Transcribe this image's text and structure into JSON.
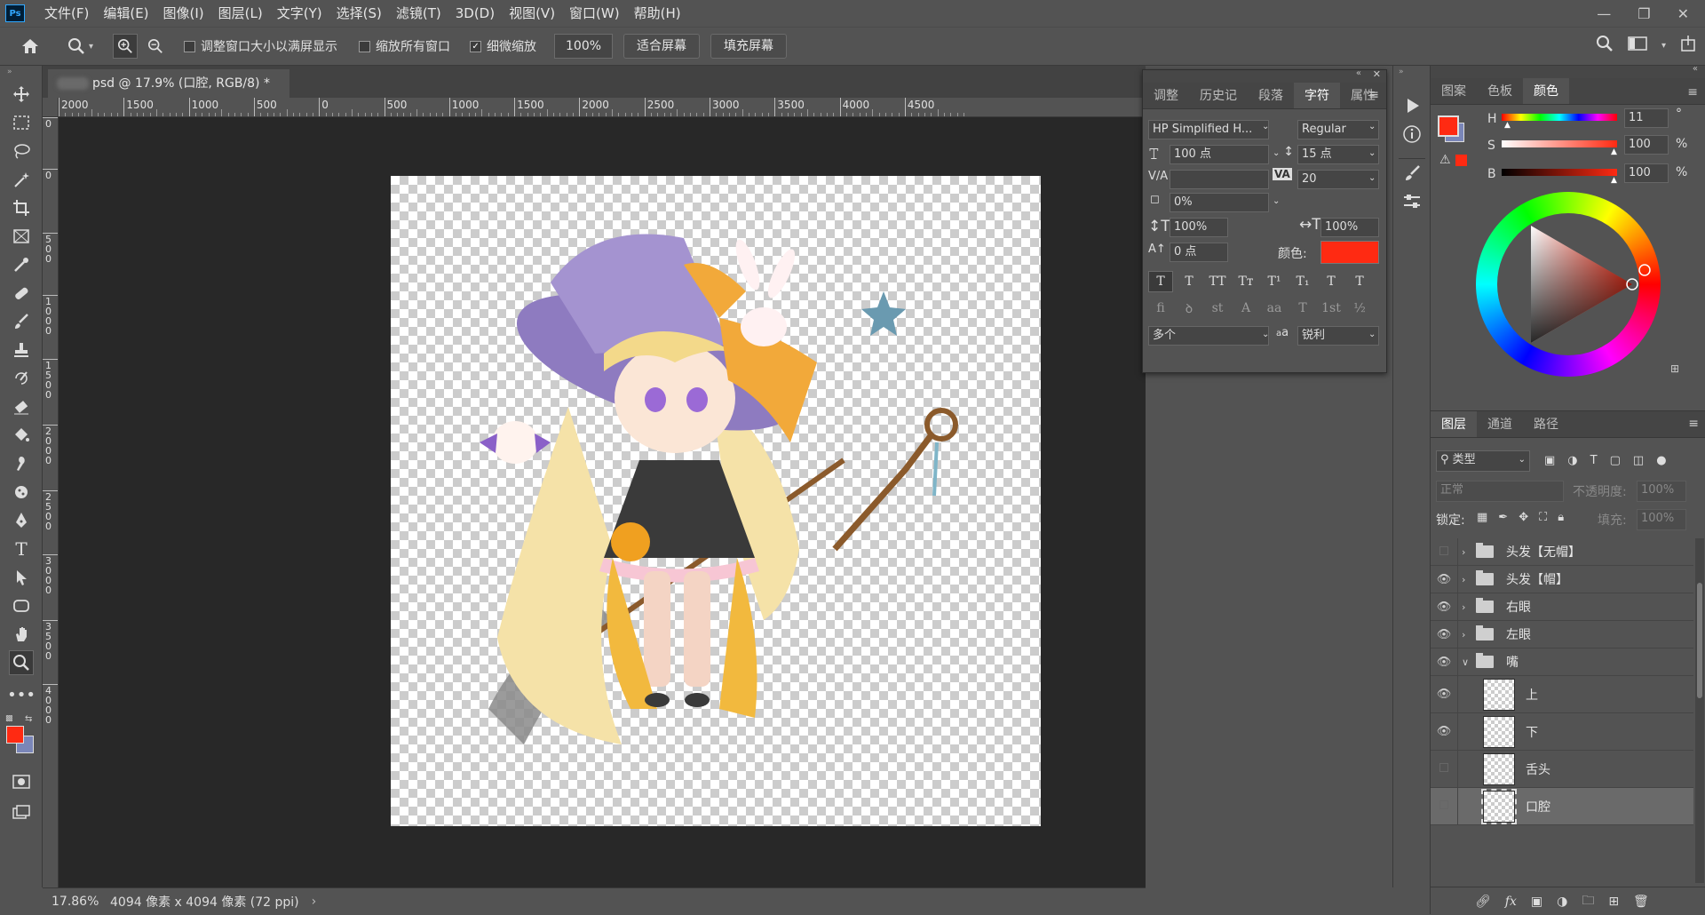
{
  "menubar": {
    "logo": "Ps",
    "items": [
      "文件(F)",
      "编辑(E)",
      "图像(I)",
      "图层(L)",
      "文字(Y)",
      "选择(S)",
      "滤镜(T)",
      "3D(D)",
      "视图(V)",
      "窗口(W)",
      "帮助(H)"
    ]
  },
  "options": {
    "resize_windows": "调整窗口大小以满屏显示",
    "zoom_all": "缩放所有窗口",
    "scrubby_zoom": "细微缩放",
    "zoom_value": "100%",
    "fit_screen": "适合屏幕",
    "fill_screen": "填充屏幕"
  },
  "document": {
    "tab_title": "psd @ 17.9% (口腔, RGB/8) *",
    "zoom_status": "17.86%",
    "size_status": "4094 像素 x 4094 像素 (72 ppi)"
  },
  "rulers": {
    "h_labels": [
      "2000",
      "1500",
      "1000",
      "500",
      "0",
      "500",
      "1000",
      "1500",
      "2000",
      "2500",
      "3000",
      "3500",
      "4000",
      "4500"
    ],
    "v_labels": [
      "0",
      "0",
      "5 0 0",
      "1 0 0 0",
      "1 5 0 0",
      "2 0 0 0",
      "2 5 0 0",
      "3 0 0 0",
      "3 5 0 0",
      "4 0 0 0"
    ]
  },
  "character_panel": {
    "tabs": [
      "调整",
      "历史记",
      "段落",
      "字符",
      "属性"
    ],
    "active_tab": "字符",
    "font_family": "HP Simplified H...",
    "font_style": "Regular",
    "font_size": "100 点",
    "leading": "15 点",
    "kerning": "",
    "tracking": "20",
    "tsume": "0%",
    "vertical_scale": "100%",
    "horizontal_scale": "100%",
    "baseline_shift": "0 点",
    "color_label": "颜色:",
    "color_value": "#ff2a12",
    "language": "多个",
    "aa_label": "a",
    "antialias": "锐利",
    "style_buttons": [
      "T",
      "T",
      "TT",
      "Tт",
      "T¹",
      "T₁",
      "T",
      "T"
    ],
    "ot_buttons": [
      "fi",
      "ꝺ",
      "st",
      "A",
      "aa",
      "T",
      "1st",
      "½"
    ]
  },
  "color_panel": {
    "tabs": [
      "图案",
      "色板",
      "颜色"
    ],
    "active_tab": "颜色",
    "h_label": "H",
    "h_value": "11",
    "h_unit": "°",
    "s_label": "S",
    "s_value": "100",
    "s_unit": "%",
    "b_label": "B",
    "b_value": "100",
    "b_unit": "%",
    "foreground": "#ff2a12",
    "background": "#7a86b8"
  },
  "layers_panel": {
    "tabs": [
      "图层",
      "通道",
      "路径"
    ],
    "active_tab": "图层",
    "filter_kind": "类型",
    "blend_mode": "正常",
    "opacity_label": "不透明度:",
    "opacity_value": "100%",
    "lock_label": "锁定:",
    "fill_label": "填充:",
    "fill_value": "100%",
    "layers": [
      {
        "name": "头发【无帽】",
        "type": "group",
        "visible": false,
        "expanded": false
      },
      {
        "name": "头发【帽】",
        "type": "group",
        "visible": true,
        "expanded": false
      },
      {
        "name": "右眼",
        "type": "group",
        "visible": true,
        "expanded": false
      },
      {
        "name": "左眼",
        "type": "group",
        "visible": true,
        "expanded": false
      },
      {
        "name": "嘴",
        "type": "group",
        "visible": true,
        "expanded": true
      },
      {
        "name": "上",
        "type": "layer",
        "visible": true
      },
      {
        "name": "下",
        "type": "layer",
        "visible": true
      },
      {
        "name": "舌头",
        "type": "layer",
        "visible": false
      },
      {
        "name": "口腔",
        "type": "layer",
        "visible": false,
        "selected": true
      }
    ]
  },
  "colors": {
    "accent": "#ff2a12",
    "ui_bg": "#535353",
    "canvas_bg": "#282828"
  }
}
